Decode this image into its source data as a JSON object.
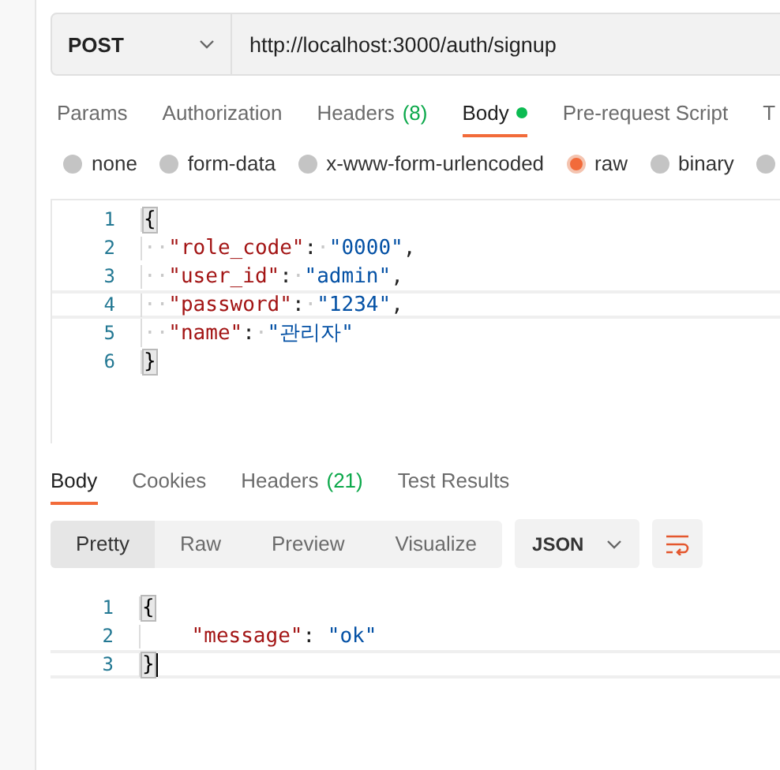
{
  "request": {
    "method": "POST",
    "url": "http://localhost:3000/auth/signup"
  },
  "request_tabs": [
    {
      "label": "Params",
      "selected": false
    },
    {
      "label": "Authorization",
      "selected": false
    },
    {
      "label": "Headers",
      "count": "(8)",
      "selected": false
    },
    {
      "label": "Body",
      "dot": true,
      "selected": true
    },
    {
      "label": "Pre-request Script",
      "selected": false
    },
    {
      "label": "T",
      "selected": false
    }
  ],
  "body_types": [
    {
      "label": "none",
      "selected": false
    },
    {
      "label": "form-data",
      "selected": false
    },
    {
      "label": "x-www-form-urlencoded",
      "selected": false
    },
    {
      "label": "raw",
      "selected": true
    },
    {
      "label": "binary",
      "selected": false
    },
    {
      "selected": false
    }
  ],
  "request_body": [
    {
      "number": "1",
      "current": false,
      "tokens": [
        {
          "kind": "bracket",
          "text": "{"
        }
      ]
    },
    {
      "number": "2",
      "current": false,
      "tokens": [
        {
          "kind": "ws",
          "text": "··"
        },
        {
          "kind": "key",
          "text": "\"role_code\""
        },
        {
          "kind": "punct",
          "text": ":"
        },
        {
          "kind": "ws",
          "text": "·"
        },
        {
          "kind": "string",
          "text": "\"0000\""
        },
        {
          "kind": "punct",
          "text": ","
        }
      ]
    },
    {
      "number": "3",
      "current": false,
      "tokens": [
        {
          "kind": "ws",
          "text": "··"
        },
        {
          "kind": "key",
          "text": "\"user_id\""
        },
        {
          "kind": "punct",
          "text": ":"
        },
        {
          "kind": "ws",
          "text": "·"
        },
        {
          "kind": "string",
          "text": "\"admin\""
        },
        {
          "kind": "punct",
          "text": ","
        }
      ]
    },
    {
      "number": "4",
      "current": true,
      "tokens": [
        {
          "kind": "ws",
          "text": "··"
        },
        {
          "kind": "key",
          "text": "\"password\""
        },
        {
          "kind": "punct",
          "text": ":"
        },
        {
          "kind": "ws",
          "text": "·"
        },
        {
          "kind": "string",
          "text": "\"1234\""
        },
        {
          "kind": "punct",
          "text": ","
        }
      ]
    },
    {
      "number": "5",
      "current": false,
      "tokens": [
        {
          "kind": "ws",
          "text": "··"
        },
        {
          "kind": "key",
          "text": "\"name\""
        },
        {
          "kind": "punct",
          "text": ":"
        },
        {
          "kind": "ws",
          "text": "·"
        },
        {
          "kind": "string",
          "text": "\"관리자\""
        }
      ]
    },
    {
      "number": "6",
      "current": false,
      "tokens": [
        {
          "kind": "bracket",
          "text": "}"
        }
      ]
    }
  ],
  "response_tabs": [
    {
      "label": "Body",
      "selected": true
    },
    {
      "label": "Cookies",
      "selected": false
    },
    {
      "label": "Headers",
      "count": "(21)",
      "selected": false
    },
    {
      "label": "Test Results",
      "selected": false
    }
  ],
  "view_modes": [
    {
      "label": "Pretty",
      "selected": true
    },
    {
      "label": "Raw",
      "selected": false
    },
    {
      "label": "Preview",
      "selected": false
    },
    {
      "label": "Visualize",
      "selected": false
    }
  ],
  "format": "JSON",
  "response_body": [
    {
      "number": "1",
      "current": false,
      "tokens": [
        {
          "kind": "bracket",
          "text": "{"
        }
      ]
    },
    {
      "number": "2",
      "current": false,
      "tokens": [
        {
          "kind": "indent"
        },
        {
          "kind": "key",
          "text": "\"message\""
        },
        {
          "kind": "punct",
          "text": ": "
        },
        {
          "kind": "string",
          "text": "\"ok\""
        }
      ]
    },
    {
      "number": "3",
      "current": true,
      "tokens": [
        {
          "kind": "bracket",
          "text": "}"
        }
      ]
    }
  ]
}
